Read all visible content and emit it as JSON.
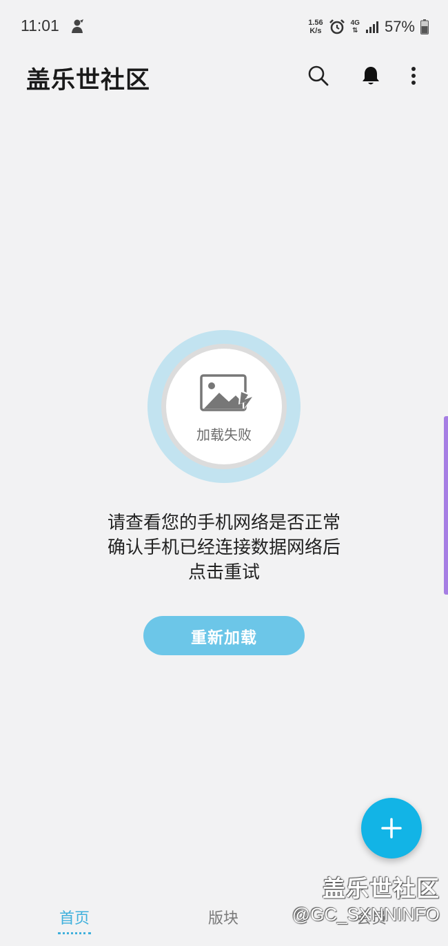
{
  "status_bar": {
    "time": "11:01",
    "net_speed_value": "1.56",
    "net_speed_unit": "K/s",
    "network_type": "4G",
    "battery_percent": "57%"
  },
  "app_bar": {
    "title": "盖乐世社区"
  },
  "error_state": {
    "image_label": "加载失败",
    "message_lines": [
      "请查看您的手机网络是否正常",
      "确认手机已经连接数据网络后",
      "点击重试"
    ],
    "reload_label": "重新加载"
  },
  "bottom_nav": {
    "items": [
      {
        "label": "首页",
        "active": true
      },
      {
        "label": "版块",
        "active": false
      },
      {
        "label": "会员",
        "active": false
      }
    ]
  },
  "watermark": {
    "title": "盖乐世社区",
    "handle": "@GC_SXNNINFO"
  },
  "colors": {
    "accent": "#3fb0dc",
    "fab": "#12b4e6",
    "reload_button": "#6cc6e8",
    "scroll_indicator": "#a67ee3",
    "background": "#f2f2f3"
  }
}
